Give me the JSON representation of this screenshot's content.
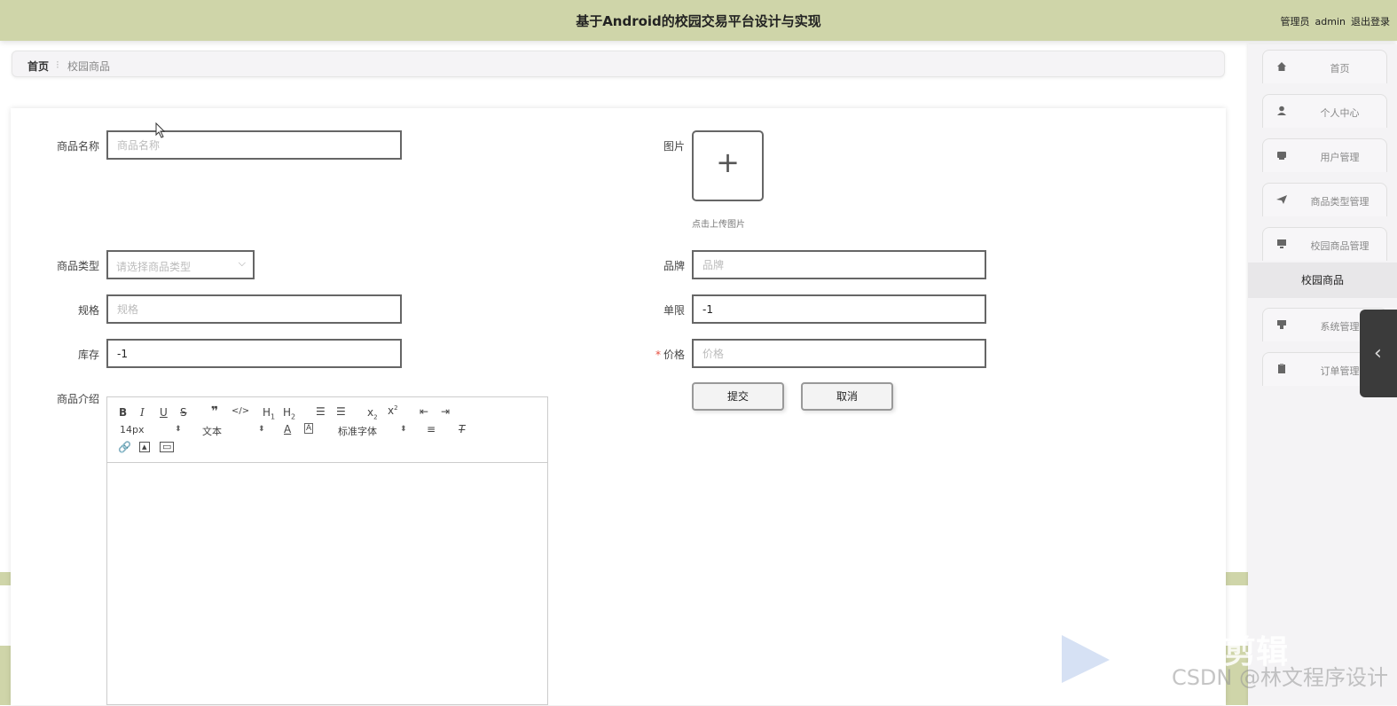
{
  "header": {
    "title": "基于Android的校园交易平台设计与实现",
    "user_role": "管理员",
    "username": "admin",
    "logout": "退出登录"
  },
  "breadcrumb": {
    "home": "首页",
    "separator": "⁝",
    "current": "校园商品"
  },
  "form": {
    "name_label": "商品名称",
    "name_placeholder": "商品名称",
    "image_label": "图片",
    "upload_hint": "点击上传图片",
    "type_label": "商品类型",
    "type_placeholder": "请选择商品类型",
    "brand_label": "品牌",
    "brand_placeholder": "品牌",
    "spec_label": "规格",
    "spec_placeholder": "规格",
    "limit_label": "单限",
    "limit_value": "-1",
    "stock_label": "库存",
    "stock_value": "-1",
    "price_required_mark": "*",
    "price_label": "价格",
    "price_placeholder": "价格",
    "intro_label": "商品介绍",
    "submit_label": "提交",
    "cancel_label": "取消"
  },
  "editor": {
    "font_size": "14px",
    "block_format": "文本",
    "font_family": "标准字体"
  },
  "sidebar": {
    "items": [
      {
        "label": "首页",
        "icon": "home-icon"
      },
      {
        "label": "个人中心",
        "icon": "person-icon"
      },
      {
        "label": "用户管理",
        "icon": "users-icon"
      },
      {
        "label": "商品类型管理",
        "icon": "send-icon"
      },
      {
        "label": "校园商品管理",
        "icon": "monitor-icon"
      },
      {
        "label": "系统管理",
        "icon": "system-icon"
      },
      {
        "label": "订单管理",
        "icon": "clipboard-icon"
      }
    ],
    "active_sub": "校园商品"
  },
  "watermark": {
    "text": "CSDN @林文程序设计",
    "big": "剪辑"
  },
  "colors": {
    "header_bg": "#cfd5a9",
    "sidebar_bg": "#f4f3f5",
    "required": "#e74c3c"
  }
}
